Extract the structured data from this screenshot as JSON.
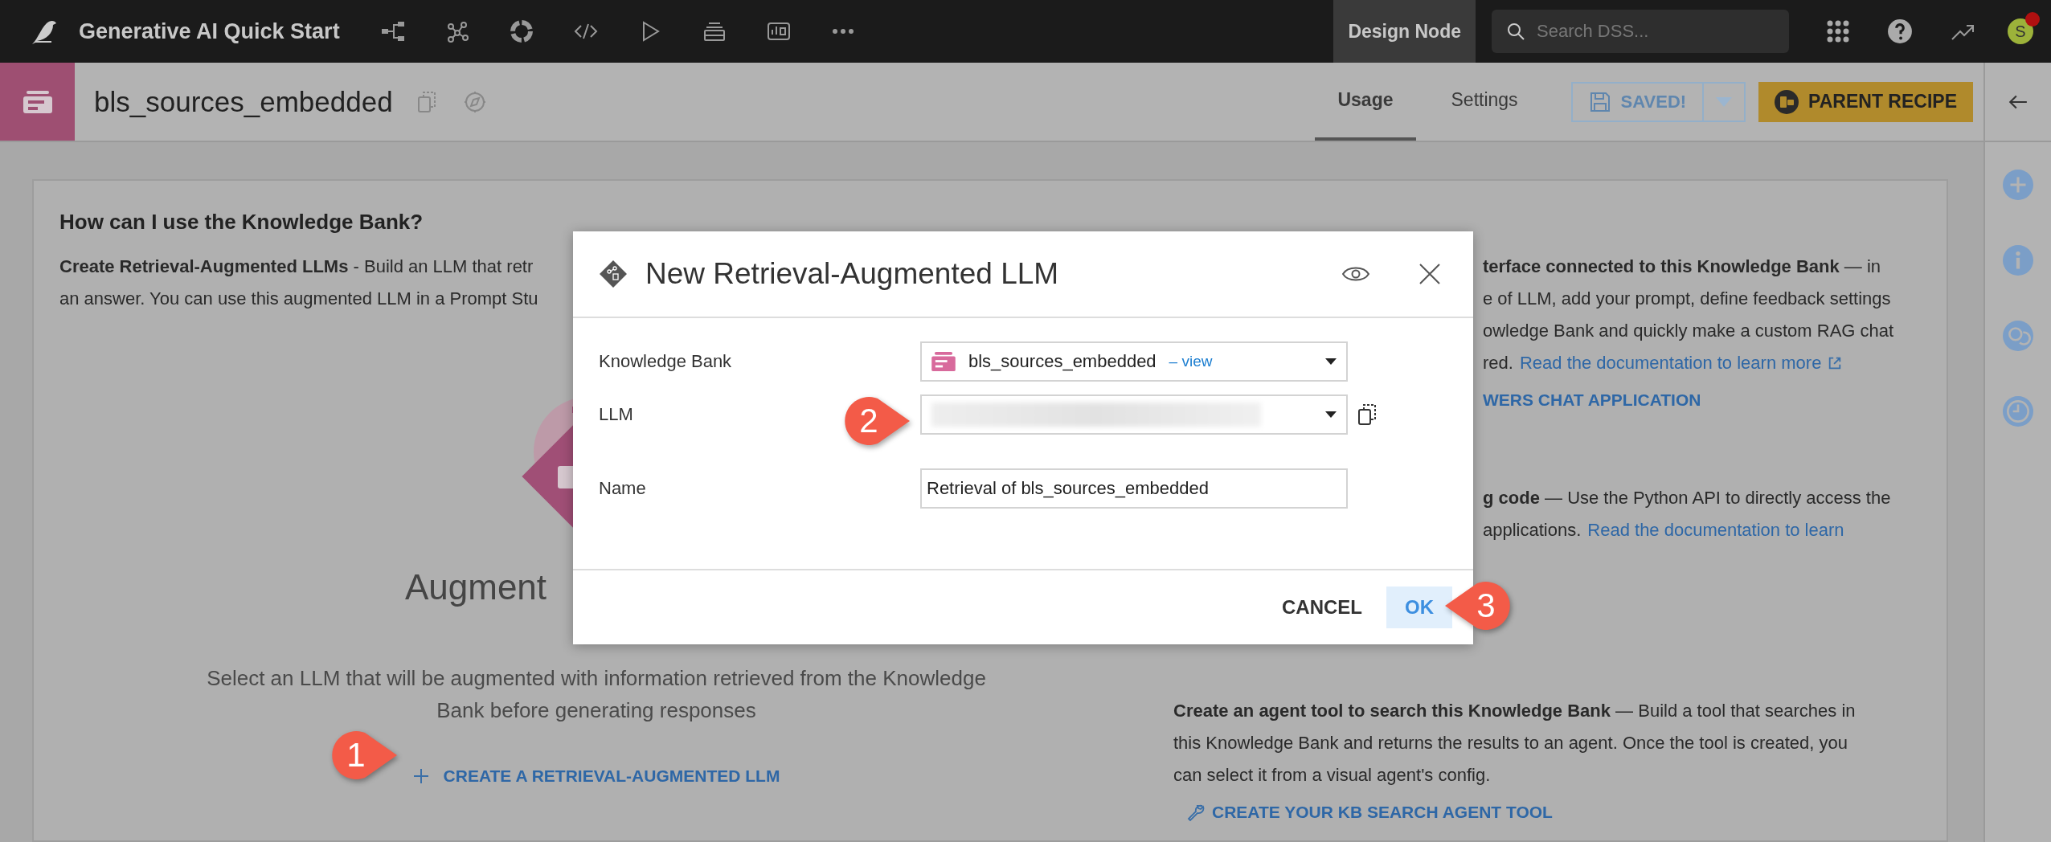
{
  "topbar": {
    "project_title": "Generative AI Quick Start",
    "node_label": "Design Node",
    "search": {
      "placeholder": "Search DSS..."
    },
    "avatar": {
      "initial": "S",
      "notification": true
    }
  },
  "header": {
    "title": "bls_sources_embedded",
    "tabs": [
      {
        "label": "Usage",
        "selected": true
      },
      {
        "label": "Settings",
        "selected": false
      }
    ],
    "save_button": {
      "label": "SAVED!",
      "disabled": true
    },
    "parent_recipe_button": {
      "label": "PARENT RECIPE"
    }
  },
  "card": {
    "heading": "How can I use the Knowledge Bank?",
    "left_lines": [
      "**Create Retrieval-Augmented LLMs** - Build an LLM that retr",
      "an answer. You can use this augmented LLM in a Prompt Stu"
    ],
    "augment_title": "Augment",
    "augment_description": [
      "Select an LLM that will be augmented with information retrieved from the Knowledge",
      "Bank before generating responses"
    ],
    "create_llm_link": "CREATE A RETRIEVAL-AUGMENTED LLM",
    "chat_lines": [
      "**terface connected to this Knowledge Bank** — in",
      "e of LLM, add your prompt, define feedback settings",
      "owledge Bank and quickly make a custom RAG chat",
      "red."
    ],
    "chat_doc_link": "Read the documentation to learn more",
    "chat_app_link": "WERS CHAT APPLICATION",
    "code_lines": [
      "**g code** — Use the Python API to directly access the",
      "applications."
    ],
    "code_doc_link": "Read the documentation to learn",
    "agent_lines": [
      "**Create an agent tool to search this Knowledge Bank** — Build a tool that searches in",
      "this Knowledge Bank and returns the results to an agent. Once the tool is created, you",
      "can select it from a visual agent's config."
    ],
    "agent_link": "CREATE YOUR KB SEARCH AGENT TOOL"
  },
  "dialog": {
    "title": "New Retrieval-Augmented LLM",
    "fields": [
      {
        "kind": "select",
        "label": "Knowledge Bank",
        "value": "bls_sources_embedded",
        "link": "– view"
      },
      {
        "kind": "blurred",
        "label": "LLM"
      },
      {
        "kind": "text",
        "label": "Name",
        "value": "Retrieval of bls_sources_embedded"
      }
    ],
    "cancel": "CANCEL",
    "ok": "OK"
  },
  "callouts": [
    {
      "label": "1",
      "points_left": false
    },
    {
      "label": "2",
      "points_left": false
    },
    {
      "label": "3",
      "points_left": true
    }
  ]
}
